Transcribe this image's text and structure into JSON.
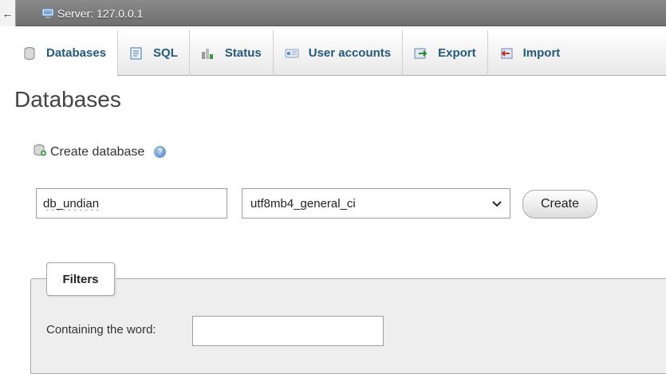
{
  "topbar": {
    "back_glyph": "←",
    "server_label": "Server: 127.0.0.1"
  },
  "tabs": [
    {
      "label": "Databases",
      "icon": "database-icon",
      "active": true
    },
    {
      "label": "SQL",
      "icon": "sql-icon",
      "active": false
    },
    {
      "label": "Status",
      "icon": "status-icon",
      "active": false
    },
    {
      "label": "User accounts",
      "icon": "user-accounts-icon",
      "active": false
    },
    {
      "label": "Export",
      "icon": "export-icon",
      "active": false
    },
    {
      "label": "Import",
      "icon": "import-icon",
      "active": false
    }
  ],
  "page": {
    "title": "Databases"
  },
  "create_database": {
    "heading": "Create database",
    "name_value": "db_undian",
    "collation_value": "utf8mb4_general_ci",
    "create_label": "Create"
  },
  "filters": {
    "legend": "Filters",
    "containing_label": "Containing the word:",
    "containing_value": ""
  },
  "colors": {
    "accent": "#235a81",
    "topbar": "#7a7a7a"
  }
}
